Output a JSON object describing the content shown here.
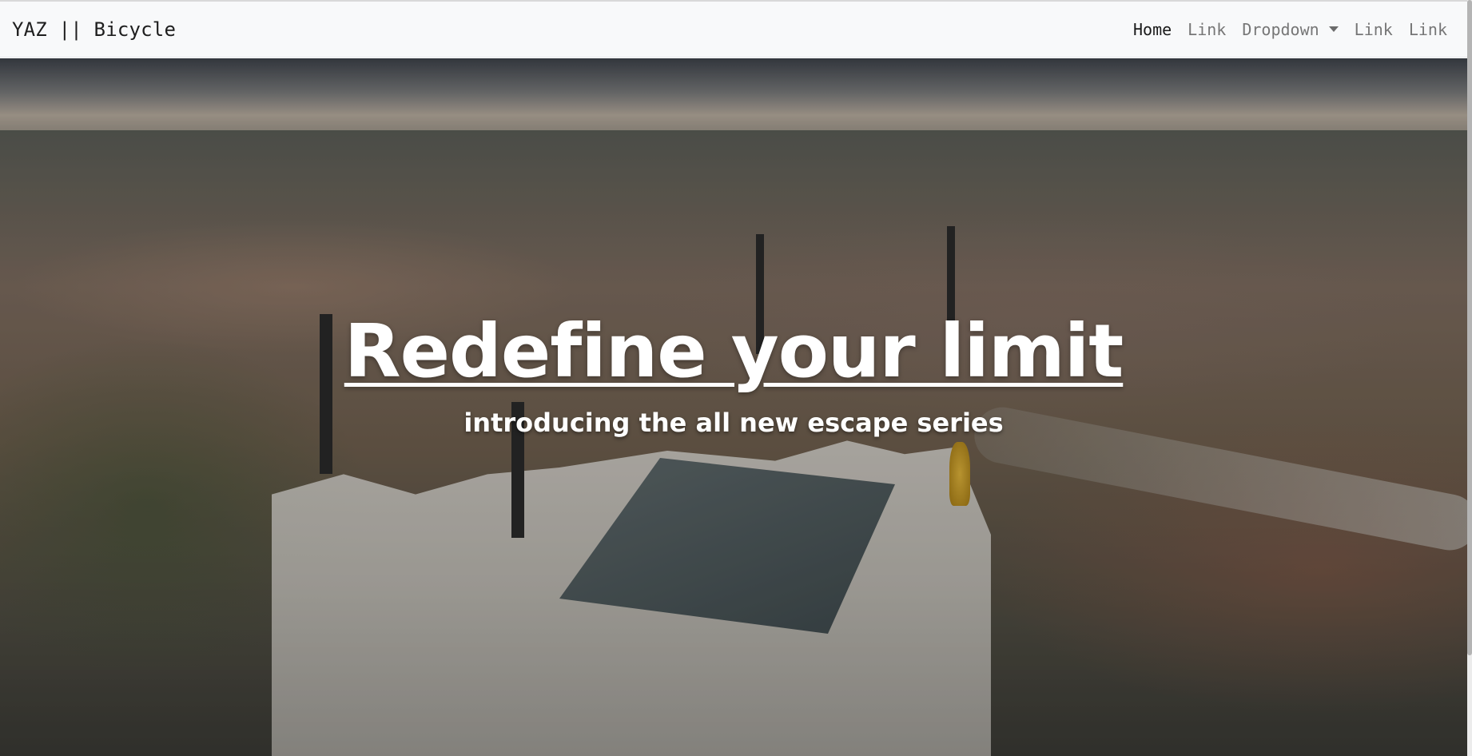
{
  "navbar": {
    "brand": "YAZ || Bicycle",
    "items": [
      {
        "label": "Home",
        "active": true
      },
      {
        "label": "Link",
        "active": false
      },
      {
        "label": "Dropdown",
        "active": false,
        "has_caret": true
      },
      {
        "label": "Link",
        "active": false
      },
      {
        "label": "Link",
        "active": false
      }
    ]
  },
  "hero": {
    "headline": "Redefine your limit",
    "subheadline": "introducing the all new escape series",
    "background": "aerial-city-cathedral-photo"
  },
  "colors": {
    "navbar_bg": "#f8f9fa",
    "brand_text": "#1e1e1e",
    "nav_link": "#767676",
    "nav_link_active": "#1a1a1a",
    "hero_text": "#ffffff"
  }
}
